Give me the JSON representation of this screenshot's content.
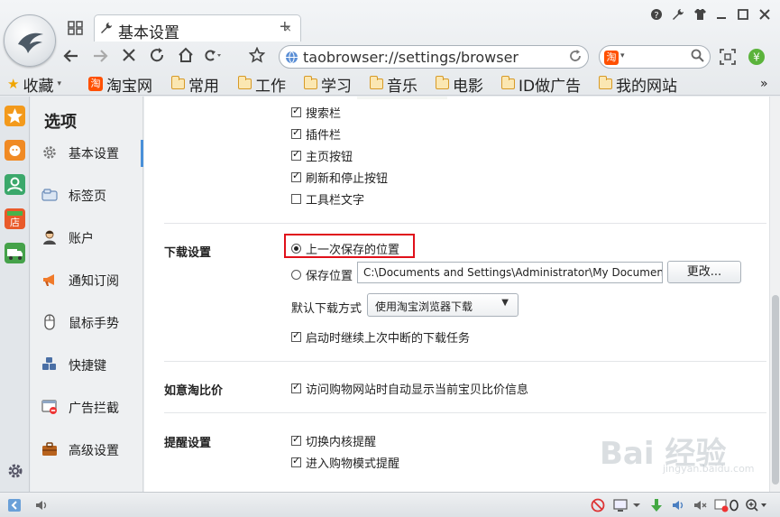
{
  "tab": {
    "title": "基本设置",
    "close": "×",
    "new_tab": "+"
  },
  "address": {
    "url": "taobrowser://settings/browser"
  },
  "search": {
    "engine_badge": "淘"
  },
  "bookmarks": {
    "favorites_label": "收藏",
    "items": [
      {
        "label": "淘宝网",
        "icon": "taobao-icon"
      },
      {
        "label": "常用",
        "icon": "folder-icon"
      },
      {
        "label": "工作",
        "icon": "folder-icon"
      },
      {
        "label": "学习",
        "icon": "folder-icon"
      },
      {
        "label": "音乐",
        "icon": "folder-icon"
      },
      {
        "label": "电影",
        "icon": "folder-icon"
      },
      {
        "label": "ID做广告",
        "icon": "folder-icon"
      },
      {
        "label": "我的网站",
        "icon": "folder-icon"
      }
    ],
    "more": "»"
  },
  "sidebar": {
    "heading": "选项",
    "items": [
      {
        "label": "基本设置",
        "icon": "gear-icon",
        "active": true
      },
      {
        "label": "标签页",
        "icon": "tab-icon"
      },
      {
        "label": "账户",
        "icon": "user-icon"
      },
      {
        "label": "通知订阅",
        "icon": "megaphone-icon"
      },
      {
        "label": "鼠标手势",
        "icon": "mouse-icon"
      },
      {
        "label": "快捷键",
        "icon": "keyboard-icon"
      },
      {
        "label": "广告拦截",
        "icon": "adblock-icon"
      },
      {
        "label": "高级设置",
        "icon": "briefcase-icon"
      }
    ]
  },
  "toolbar_options": [
    {
      "label": "搜索栏",
      "checked": true
    },
    {
      "label": "插件栏",
      "checked": true
    },
    {
      "label": "主页按钮",
      "checked": true
    },
    {
      "label": "刷新和停止按钮",
      "checked": true
    },
    {
      "label": "工具栏文字",
      "checked": false
    }
  ],
  "download": {
    "section_label": "下载设置",
    "last_location": "上一次保存的位置",
    "save_location": "保存位置",
    "path": "C:\\Documents and Settings\\Administrator\\My Documents",
    "change_button": "更改...",
    "default_method_label": "默认下载方式",
    "default_method_value": "使用淘宝浏览器下载",
    "resume_label": "启动时继续上次中断的下载任务"
  },
  "price_compare": {
    "section_label": "如意淘比价",
    "option": "访问购物网站时自动显示当前宝贝比价信息"
  },
  "reminders": {
    "section_label": "提醒设置",
    "options": [
      {
        "label": "切换内核提醒",
        "checked": true
      },
      {
        "label": "进入购物模式提醒",
        "checked": true
      }
    ]
  },
  "watermark": {
    "text": "Bai 经验",
    "sub": "jingyan.baidu.com"
  },
  "colors": {
    "highlight": "#e0101a",
    "accent": "#4a90d9",
    "brand": "#ff5000"
  }
}
